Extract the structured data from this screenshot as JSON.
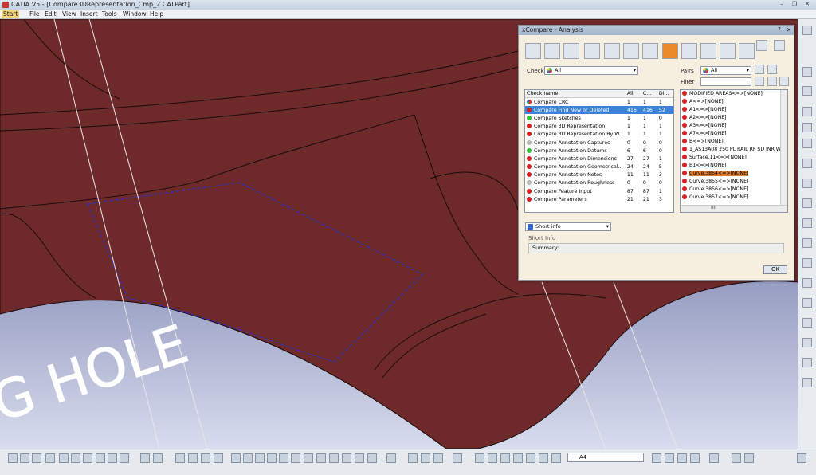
{
  "window": {
    "title": "CATIA V5 - [Compare3DRepresentation_Cmp_2.CATPart]",
    "min_glyph": "–",
    "restore_glyph": "❐",
    "close_glyph": "✕"
  },
  "menu": {
    "start": "Start",
    "file": "File",
    "edit": "Edit",
    "view": "View",
    "insert": "Insert",
    "tools": "Tools",
    "window": "Window",
    "help": "Help"
  },
  "viewport": {
    "model_text": "G HOLE",
    "body_color": "#6e2a2a",
    "edge_color": "#1a0a0a",
    "background_color": "#3f4a8a",
    "selection_color": "#2233ee"
  },
  "dialog": {
    "title": "xCompare - Analysis",
    "help_glyph": "?",
    "close_glyph": "✕",
    "checks_label": "Checks",
    "checks_value": "All",
    "pairs_label": "Pairs",
    "pairs_value": "All",
    "filter_label": "Filter",
    "filter_value": "",
    "table": {
      "headers": [
        "Check name",
        "All",
        "C...",
        "Di..."
      ],
      "rows": [
        {
          "name": "Compare CRC",
          "all": "1",
          "c": "1",
          "d": "1",
          "status": "mixed",
          "selected": false
        },
        {
          "name": "Compare Find New or Deleted",
          "all": "416",
          "c": "416",
          "d": "52",
          "status": "red",
          "selected": true
        },
        {
          "name": "Compare Sketches",
          "all": "1",
          "c": "1",
          "d": "0",
          "status": "green",
          "selected": false
        },
        {
          "name": "Compare 3D Representation",
          "all": "1",
          "c": "1",
          "d": "1",
          "status": "red",
          "selected": false
        },
        {
          "name": "Compare 3D Representation By W...",
          "all": "1",
          "c": "1",
          "d": "1",
          "status": "red",
          "selected": false
        },
        {
          "name": "Compare Annotation Captures",
          "all": "0",
          "c": "0",
          "d": "0",
          "status": "grey",
          "selected": false
        },
        {
          "name": "Compare Annotation Datums",
          "all": "6",
          "c": "6",
          "d": "0",
          "status": "green",
          "selected": false
        },
        {
          "name": "Compare Annotation Dimensions",
          "all": "27",
          "c": "27",
          "d": "1",
          "status": "red",
          "selected": false
        },
        {
          "name": "Compare Annotation Geometrical...",
          "all": "24",
          "c": "24",
          "d": "5",
          "status": "red",
          "selected": false
        },
        {
          "name": "Compare Annotation Notes",
          "all": "11",
          "c": "11",
          "d": "3",
          "status": "red",
          "selected": false
        },
        {
          "name": "Compare Annotation Roughness",
          "all": "0",
          "c": "0",
          "d": "0",
          "status": "grey",
          "selected": false
        },
        {
          "name": "Compare Feature Input",
          "all": "87",
          "c": "87",
          "d": "1",
          "status": "red",
          "selected": false
        },
        {
          "name": "Compare Parameters",
          "all": "21",
          "c": "21",
          "d": "3",
          "status": "red",
          "selected": false
        }
      ]
    },
    "pairs": [
      {
        "text": "MODIFIED AREAS<=>[NONE]",
        "selected": false
      },
      {
        "text": "A<=>[NONE]",
        "selected": false
      },
      {
        "text": "A1<=>[NONE]",
        "selected": false
      },
      {
        "text": "A2<=>[NONE]",
        "selected": false
      },
      {
        "text": "A3<=>[NONE]",
        "selected": false
      },
      {
        "text": "A7<=>[NONE]",
        "selected": false
      },
      {
        "text": "B<=>[NONE]",
        "selected": false
      },
      {
        "text": "1_AS13A08 250 PL RAIL RF SD INR WITH",
        "selected": false
      },
      {
        "text": "Surface.11<=>[NONE]",
        "selected": false
      },
      {
        "text": "B1<=>[NONE]",
        "selected": false
      },
      {
        "text": "Curve.3854<=>[NONE]",
        "selected": true
      },
      {
        "text": "Curve.3855<=>[NONE]",
        "selected": false
      },
      {
        "text": "Curve.3856<=>[NONE]",
        "selected": false
      },
      {
        "text": "Curve.3857<=>[NONE]",
        "selected": false
      }
    ],
    "scroll_glyph_h": "⁞⁞⁞",
    "info_mode": "Short info",
    "short_info_label": "Short Info",
    "summary_label": "Summary:",
    "ok_label": "OK",
    "status_colors": {
      "red": "#d42020",
      "green": "#2fbf2f",
      "grey": "#b5b5b5",
      "mixed": "#c44"
    }
  },
  "toolbar": {
    "scale_value": "A4"
  },
  "right_toolbar_icons": [
    "select-icon",
    "sketch-icon",
    "pencil-icon",
    "compass-icon",
    "cube-icon",
    "analysis-icon"
  ],
  "bottom_toolbar_icons": [
    "new-icon",
    "open-icon",
    "save-icon",
    "print-icon",
    "cut-icon",
    "copy-icon",
    "paste-icon",
    "undo-icon",
    "redo-icon",
    "help-icon",
    "formula-icon",
    "search-icon",
    "pan-icon",
    "rotate-icon",
    "zoom-in-icon",
    "zoom-out-icon",
    "view-icon",
    "render-icon",
    "hide-icon",
    "swap-icon"
  ]
}
